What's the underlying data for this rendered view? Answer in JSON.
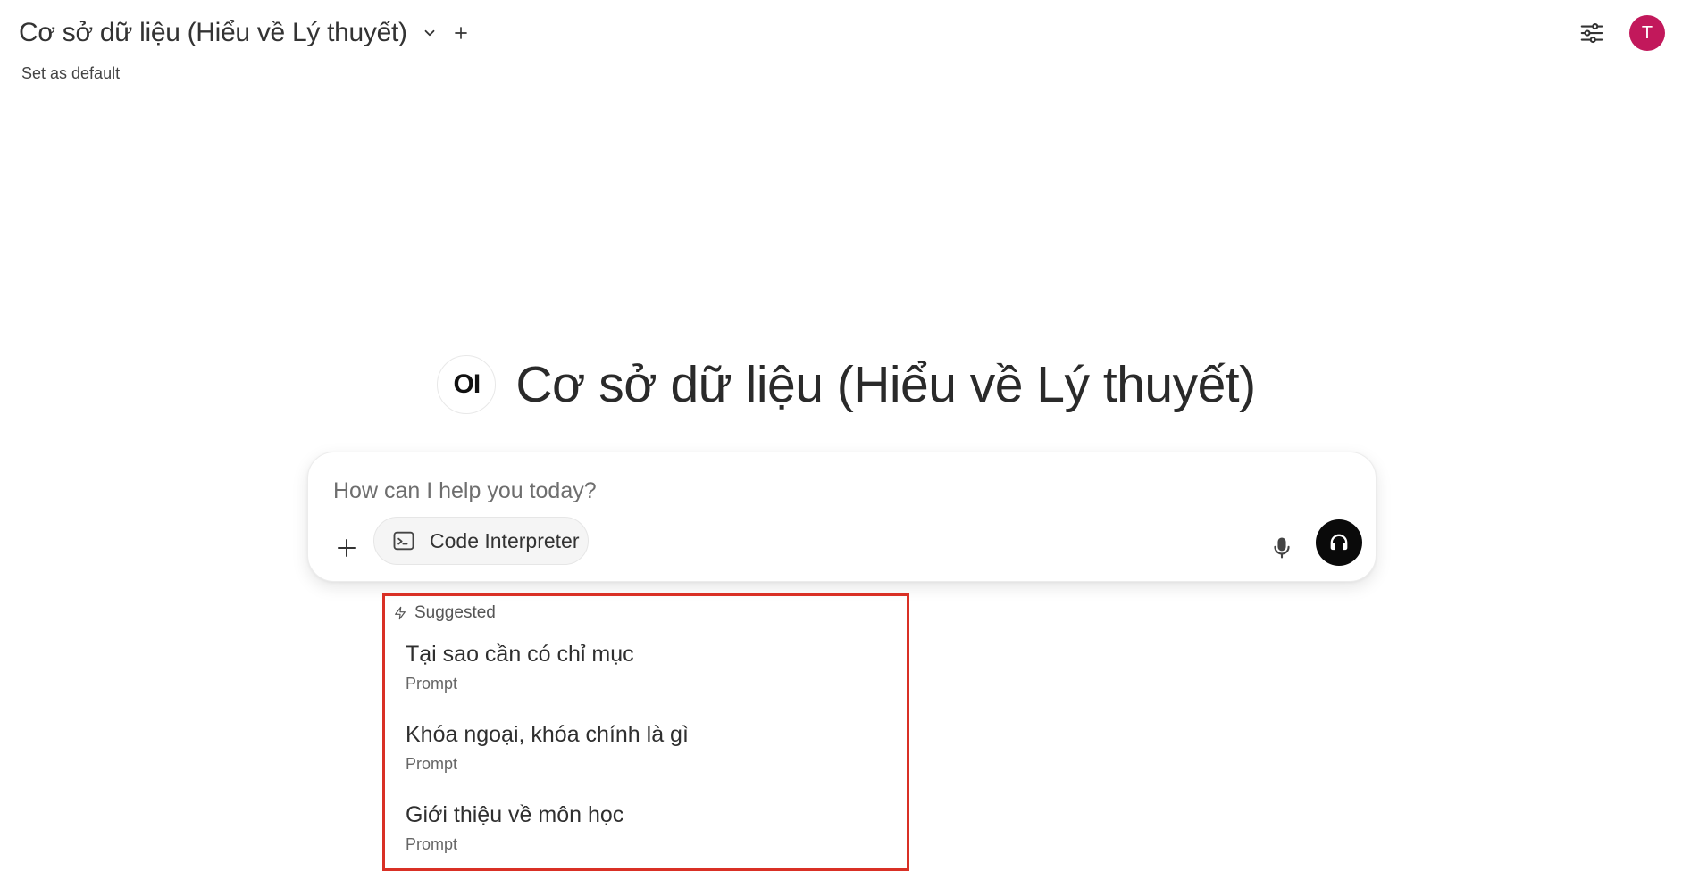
{
  "header": {
    "model_name": "Cơ sở dữ liệu (Hiểu về Lý thuyết)",
    "set_default_label": "Set as default",
    "avatar_initial": "T",
    "avatar_color": "#c2185b"
  },
  "hero": {
    "logo_text": "OI",
    "title": "Cơ sở dữ liệu (Hiểu về Lý thuyết)"
  },
  "chat": {
    "placeholder": "How can I help you today?",
    "code_interpreter_label": "Code Interpreter"
  },
  "suggestions": {
    "header_label": "Suggested",
    "highlight_color": "#d93025",
    "items": [
      {
        "title": "Tại sao cần có chỉ mục",
        "subtitle": "Prompt"
      },
      {
        "title": "Khóa ngoại, khóa chính là gì",
        "subtitle": "Prompt"
      },
      {
        "title": "Giới thiệu về môn học",
        "subtitle": "Prompt"
      }
    ]
  }
}
